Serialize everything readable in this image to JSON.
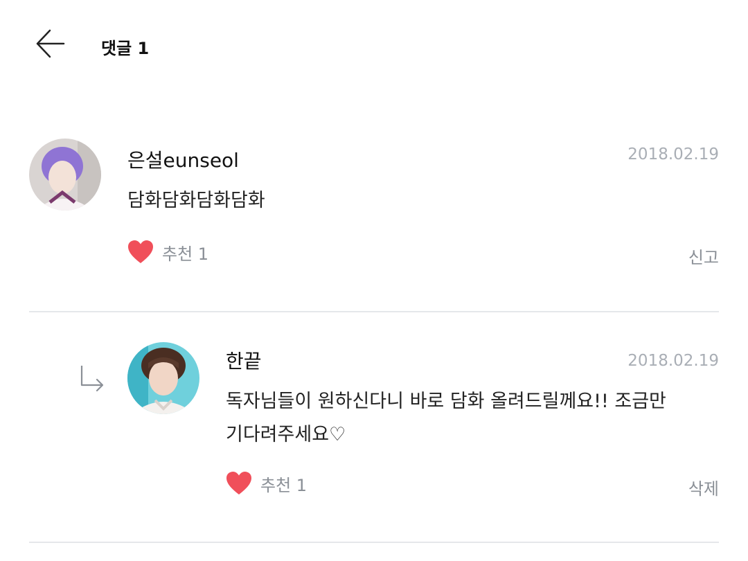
{
  "header": {
    "title": "댓글 1",
    "back_icon": "arrow-left-icon"
  },
  "comments": [
    {
      "author": "은설eunseol",
      "date": "2018.02.19",
      "text": "담화담화담화담화",
      "like_label": "추천 1",
      "action_label": "신고",
      "avatar_colors": [
        "#9a7ed6",
        "#f2e4dd"
      ]
    },
    {
      "author": "한끝",
      "date": "2018.02.19",
      "text_line1": "독자님들이 원하신다니 바로 담화 올려드릴께요!! 조금만",
      "text_line2": "기다려주세요♡",
      "like_label": "추천 1",
      "action_label": "삭제",
      "is_reply": true,
      "avatar_colors": [
        "#5a3a2c",
        "#6fd0dc"
      ]
    }
  ],
  "colors": {
    "heart": "#f04f5a",
    "date": "#a9aeb5",
    "muted": "#8a8f96",
    "divider": "#e5e7ea"
  }
}
